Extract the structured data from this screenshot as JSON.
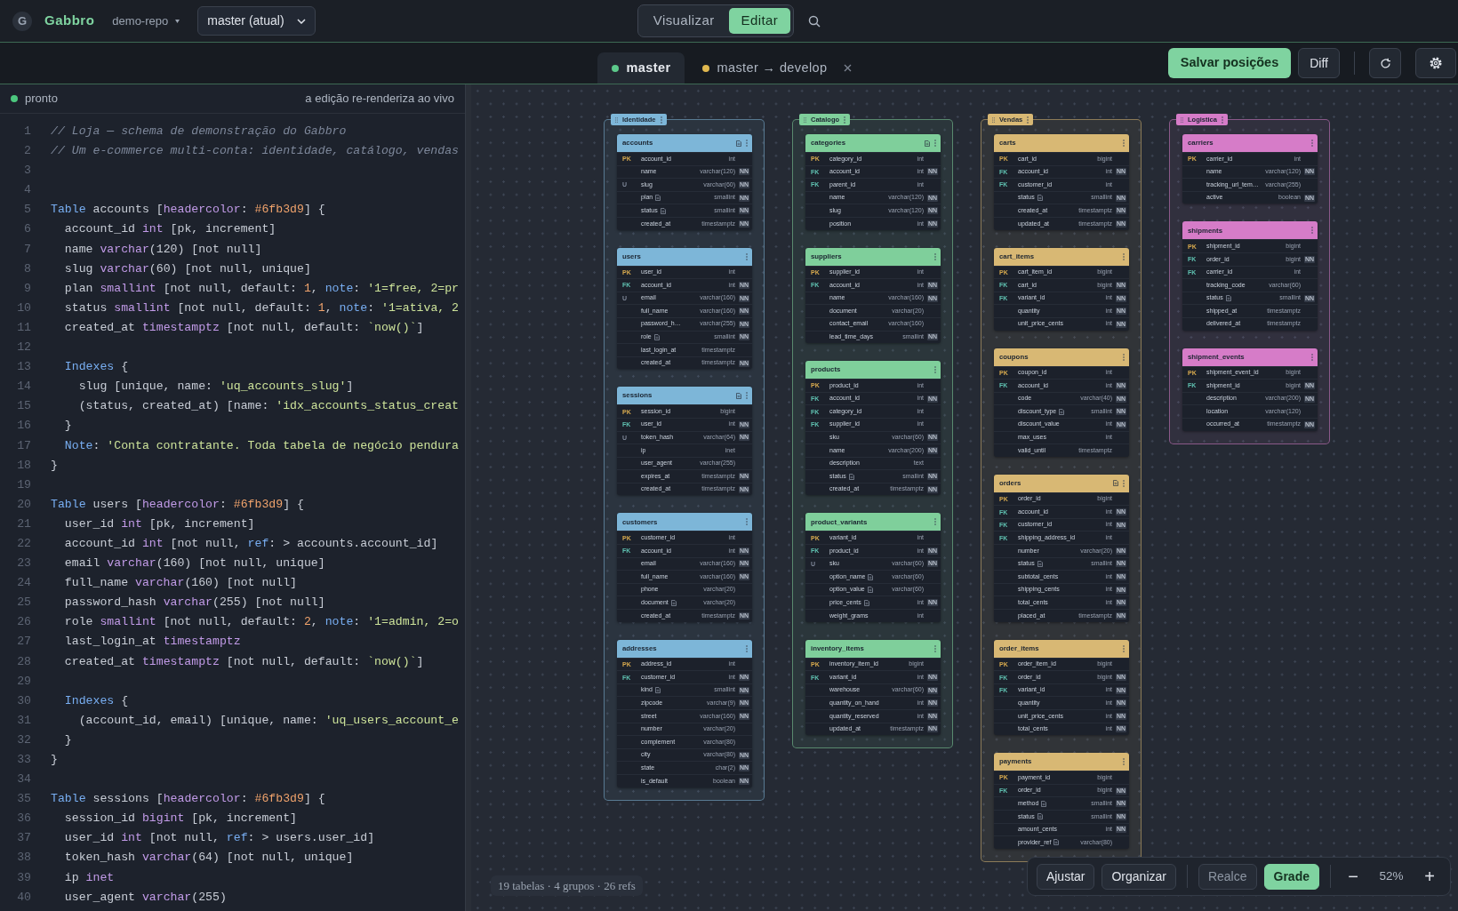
{
  "app": {
    "logo": "G",
    "name": "Gabbro",
    "repo": "demo-repo",
    "branch": "master (atual)"
  },
  "mode_tabs": [
    {
      "label": "Visualizar",
      "selected": false
    },
    {
      "label": "Editar",
      "selected": true
    }
  ],
  "file_tabs": [
    {
      "label": "master",
      "color": "#5cc98b",
      "selected": true,
      "closable": false
    },
    {
      "label": "master → develop",
      "color": "#e0b84f",
      "selected": false,
      "closable": true
    }
  ],
  "actions": {
    "save": "Salvar posições",
    "diff": "Diff"
  },
  "editor": {
    "status": "pronto",
    "status_ok": true,
    "hint": "a edição re-renderiza ao vivo",
    "lines": [
      {
        "n": "1",
        "s": [
          {
            "c": "// Loja — schema de demonstração do Gabbro"
          }
        ]
      },
      {
        "n": "2",
        "s": [
          {
            "c": "// Um e-commerce multi-conta: identidade, catálogo, vendas"
          }
        ]
      },
      {
        "n": "3"
      },
      {
        "n": "4"
      },
      {
        "n": "5",
        "s": [
          {
            "k": "Table"
          },
          {
            "p": " accounts ["
          },
          {
            "t": "headercolor"
          },
          {
            "p": ": "
          },
          {
            "n": "#6fb3d9"
          },
          {
            "p": "] {"
          }
        ]
      },
      {
        "n": "6",
        "s": [
          {
            "p": "  account_id "
          },
          {
            "t": "int"
          },
          {
            "p": " [pk, increment]"
          }
        ]
      },
      {
        "n": "7",
        "s": [
          {
            "p": "  name "
          },
          {
            "t": "varchar"
          },
          {
            "p": "(120) [not null]"
          }
        ]
      },
      {
        "n": "8",
        "s": [
          {
            "p": "  slug "
          },
          {
            "t": "varchar"
          },
          {
            "p": "(60) [not null, unique]"
          }
        ]
      },
      {
        "n": "9",
        "s": [
          {
            "p": "  plan "
          },
          {
            "t": "smallint"
          },
          {
            "p": " [not null, default: "
          },
          {
            "n": "1"
          },
          {
            "p": ", "
          },
          {
            "k": "note"
          },
          {
            "p": ": "
          },
          {
            "s": "'1=free, 2=pr"
          }
        ]
      },
      {
        "n": "10",
        "s": [
          {
            "p": "  status "
          },
          {
            "t": "smallint"
          },
          {
            "p": " [not null, default: "
          },
          {
            "n": "1"
          },
          {
            "p": ", "
          },
          {
            "k": "note"
          },
          {
            "p": ": "
          },
          {
            "s": "'1=ativa, 2"
          }
        ]
      },
      {
        "n": "11",
        "s": [
          {
            "p": "  created_at "
          },
          {
            "t": "timestamptz"
          },
          {
            "p": " [not null, default: "
          },
          {
            "s": "`now()`"
          },
          {
            "p": "]"
          }
        ]
      },
      {
        "n": "12"
      },
      {
        "n": "13",
        "s": [
          {
            "k": "  Indexes"
          },
          {
            "p": " {"
          }
        ]
      },
      {
        "n": "14",
        "s": [
          {
            "p": "    slug [unique, name: "
          },
          {
            "s": "'uq_accounts_slug'"
          },
          {
            "p": "]"
          }
        ]
      },
      {
        "n": "15",
        "s": [
          {
            "p": "    (status, created_at) [name: "
          },
          {
            "s": "'idx_accounts_status_creat"
          }
        ]
      },
      {
        "n": "16",
        "s": [
          {
            "p": "  }"
          }
        ]
      },
      {
        "n": "17",
        "s": [
          {
            "k": "  Note"
          },
          {
            "p": ": "
          },
          {
            "s": "'Conta contratante. Toda tabela de negócio pendura"
          }
        ]
      },
      {
        "n": "18",
        "s": [
          {
            "p": "}"
          }
        ]
      },
      {
        "n": "19"
      },
      {
        "n": "20",
        "s": [
          {
            "k": "Table"
          },
          {
            "p": " users ["
          },
          {
            "t": "headercolor"
          },
          {
            "p": ": "
          },
          {
            "n": "#6fb3d9"
          },
          {
            "p": "] {"
          }
        ]
      },
      {
        "n": "21",
        "s": [
          {
            "p": "  user_id "
          },
          {
            "t": "int"
          },
          {
            "p": " [pk, increment]"
          }
        ]
      },
      {
        "n": "22",
        "s": [
          {
            "p": "  account_id "
          },
          {
            "t": "int"
          },
          {
            "p": " [not null, "
          },
          {
            "k": "ref"
          },
          {
            "p": ": > accounts.account_id]"
          }
        ]
      },
      {
        "n": "23",
        "s": [
          {
            "p": "  email "
          },
          {
            "t": "varchar"
          },
          {
            "p": "(160) [not null, unique]"
          }
        ]
      },
      {
        "n": "24",
        "s": [
          {
            "p": "  full_name "
          },
          {
            "t": "varchar"
          },
          {
            "p": "(160) [not null]"
          }
        ]
      },
      {
        "n": "25",
        "s": [
          {
            "p": "  password_hash "
          },
          {
            "t": "varchar"
          },
          {
            "p": "(255) [not null]"
          }
        ]
      },
      {
        "n": "26",
        "s": [
          {
            "p": "  role "
          },
          {
            "t": "smallint"
          },
          {
            "p": " [not null, default: "
          },
          {
            "n": "2"
          },
          {
            "p": ", "
          },
          {
            "k": "note"
          },
          {
            "p": ": "
          },
          {
            "s": "'1=admin, 2=o"
          }
        ]
      },
      {
        "n": "27",
        "s": [
          {
            "p": "  last_login_at "
          },
          {
            "t": "timestamptz"
          }
        ]
      },
      {
        "n": "28",
        "s": [
          {
            "p": "  created_at "
          },
          {
            "t": "timestamptz"
          },
          {
            "p": " [not null, default: "
          },
          {
            "s": "`now()`"
          },
          {
            "p": "]"
          }
        ]
      },
      {
        "n": "29"
      },
      {
        "n": "30",
        "s": [
          {
            "k": "  Indexes"
          },
          {
            "p": " {"
          }
        ]
      },
      {
        "n": "31",
        "s": [
          {
            "p": "    (account_id, email) [unique, name: "
          },
          {
            "s": "'uq_users_account_e"
          }
        ]
      },
      {
        "n": "32",
        "s": [
          {
            "p": "  }"
          }
        ]
      },
      {
        "n": "33",
        "s": [
          {
            "p": "}"
          }
        ]
      },
      {
        "n": "34"
      },
      {
        "n": "35",
        "s": [
          {
            "k": "Table"
          },
          {
            "p": " sessions ["
          },
          {
            "t": "headercolor"
          },
          {
            "p": ": "
          },
          {
            "n": "#6fb3d9"
          },
          {
            "p": "] {"
          }
        ]
      },
      {
        "n": "36",
        "s": [
          {
            "p": "  session_id "
          },
          {
            "t": "bigint"
          },
          {
            "p": " [pk, increment]"
          }
        ]
      },
      {
        "n": "37",
        "s": [
          {
            "p": "  user_id "
          },
          {
            "t": "int"
          },
          {
            "p": " [not null, "
          },
          {
            "k": "ref"
          },
          {
            "p": ": > users.user_id]"
          }
        ]
      },
      {
        "n": "38",
        "s": [
          {
            "p": "  token_hash "
          },
          {
            "t": "varchar"
          },
          {
            "p": "(64) [not null, unique]"
          }
        ]
      },
      {
        "n": "39",
        "s": [
          {
            "p": "  ip "
          },
          {
            "t": "inet"
          }
        ]
      },
      {
        "n": "40",
        "s": [
          {
            "p": "  user_agent "
          },
          {
            "t": "varchar"
          },
          {
            "p": "(255)"
          }
        ]
      }
    ]
  },
  "canvas": {
    "stats": "19 tabelas · 4 grupos · 26 refs",
    "groups": [
      {
        "name": "Identidade",
        "color": "#7db6d8",
        "tables": [
          {
            "name": "accounts",
            "note": true,
            "columns": [
              {
                "key": "PK",
                "name": "account_id",
                "note": false,
                "type": "int"
              },
              {
                "name": "name",
                "note": false,
                "type": "varchar(120)",
                "nn": "NN"
              },
              {
                "key": "U",
                "name": "slug",
                "note": false,
                "type": "varchar(60)",
                "nn": "NN"
              },
              {
                "name": "plan",
                "note": true,
                "type": "smallint",
                "nn": "NN"
              },
              {
                "name": "status",
                "note": true,
                "type": "smallint",
                "nn": "NN"
              },
              {
                "name": "created_at",
                "note": false,
                "type": "timestamptz",
                "nn": "NN"
              }
            ]
          },
          {
            "name": "users",
            "note": false,
            "columns": [
              {
                "key": "PK",
                "name": "user_id",
                "note": false,
                "type": "int"
              },
              {
                "key": "FK",
                "name": "account_id",
                "note": false,
                "type": "int",
                "nn": "NN"
              },
              {
                "key": "U",
                "name": "email",
                "note": false,
                "type": "varchar(160)",
                "nn": "NN"
              },
              {
                "name": "full_name",
                "note": false,
                "type": "varchar(160)",
                "nn": "NN"
              },
              {
                "name": "password_h…",
                "note": false,
                "type": "varchar(255)",
                "nn": "NN"
              },
              {
                "name": "role",
                "note": true,
                "type": "smallint",
                "nn": "NN"
              },
              {
                "name": "last_login_at",
                "note": false,
                "type": "timestamptz"
              },
              {
                "name": "created_at",
                "note": false,
                "type": "timestamptz",
                "nn": "NN"
              }
            ]
          },
          {
            "name": "sessions",
            "note": true,
            "columns": [
              {
                "key": "PK",
                "name": "session_id",
                "note": false,
                "type": "bigint"
              },
              {
                "key": "FK",
                "name": "user_id",
                "note": false,
                "type": "int",
                "nn": "NN"
              },
              {
                "key": "U",
                "name": "token_hash",
                "note": false,
                "type": "varchar(64)",
                "nn": "NN"
              },
              {
                "name": "ip",
                "note": false,
                "type": "inet"
              },
              {
                "name": "user_agent",
                "note": false,
                "type": "varchar(255)"
              },
              {
                "name": "expires_at",
                "note": false,
                "type": "timestamptz",
                "nn": "NN"
              },
              {
                "name": "created_at",
                "note": false,
                "type": "timestamptz",
                "nn": "NN"
              }
            ]
          },
          {
            "name": "customers",
            "note": false,
            "columns": [
              {
                "key": "PK",
                "name": "customer_id",
                "note": false,
                "type": "int"
              },
              {
                "key": "FK",
                "name": "account_id",
                "note": false,
                "type": "int",
                "nn": "NN"
              },
              {
                "name": "email",
                "note": false,
                "type": "varchar(160)",
                "nn": "NN"
              },
              {
                "name": "full_name",
                "note": false,
                "type": "varchar(160)",
                "nn": "NN"
              },
              {
                "name": "phone",
                "note": false,
                "type": "varchar(20)"
              },
              {
                "name": "document",
                "note": true,
                "type": "varchar(20)"
              },
              {
                "name": "created_at",
                "note": false,
                "type": "timestamptz",
                "nn": "NN"
              }
            ]
          },
          {
            "name": "addresses",
            "note": false,
            "columns": [
              {
                "key": "PK",
                "name": "address_id",
                "note": false,
                "type": "int"
              },
              {
                "key": "FK",
                "name": "customer_id",
                "note": false,
                "type": "int",
                "nn": "NN"
              },
              {
                "name": "kind",
                "note": true,
                "type": "smallint",
                "nn": "NN"
              },
              {
                "name": "zipcode",
                "note": false,
                "type": "varchar(9)",
                "nn": "NN"
              },
              {
                "name": "street",
                "note": false,
                "type": "varchar(160)",
                "nn": "NN"
              },
              {
                "name": "number",
                "note": false,
                "type": "varchar(20)"
              },
              {
                "name": "complement",
                "note": false,
                "type": "varchar(80)"
              },
              {
                "name": "city",
                "note": false,
                "type": "varchar(80)",
                "nn": "NN"
              },
              {
                "name": "state",
                "note": false,
                "type": "char(2)",
                "nn": "NN"
              },
              {
                "name": "is_default",
                "note": false,
                "type": "boolean",
                "nn": "NN"
              }
            ]
          }
        ]
      },
      {
        "name": "Catalogo",
        "color": "#7fcf9b",
        "tables": [
          {
            "name": "categories",
            "note": true,
            "columns": [
              {
                "key": "PK",
                "name": "category_id",
                "note": false,
                "type": "int"
              },
              {
                "key": "FK",
                "name": "account_id",
                "note": false,
                "type": "int",
                "nn": "NN"
              },
              {
                "key": "FK",
                "name": "parent_id",
                "note": false,
                "type": "int"
              },
              {
                "name": "name",
                "note": false,
                "type": "varchar(120)",
                "nn": "NN"
              },
              {
                "name": "slug",
                "note": false,
                "type": "varchar(120)",
                "nn": "NN"
              },
              {
                "name": "position",
                "note": false,
                "type": "int",
                "nn": "NN"
              }
            ]
          },
          {
            "name": "suppliers",
            "note": false,
            "columns": [
              {
                "key": "PK",
                "name": "supplier_id",
                "note": false,
                "type": "int"
              },
              {
                "key": "FK",
                "name": "account_id",
                "note": false,
                "type": "int",
                "nn": "NN"
              },
              {
                "name": "name",
                "note": false,
                "type": "varchar(160)",
                "nn": "NN"
              },
              {
                "name": "document",
                "note": false,
                "type": "varchar(20)"
              },
              {
                "name": "contact_email",
                "note": false,
                "type": "varchar(160)"
              },
              {
                "name": "lead_time_days",
                "note": false,
                "type": "smallint",
                "nn": "NN"
              }
            ]
          },
          {
            "name": "products",
            "note": false,
            "columns": [
              {
                "key": "PK",
                "name": "product_id",
                "note": false,
                "type": "int"
              },
              {
                "key": "FK",
                "name": "account_id",
                "note": false,
                "type": "int",
                "nn": "NN"
              },
              {
                "key": "FK",
                "name": "category_id",
                "note": false,
                "type": "int"
              },
              {
                "key": "FK",
                "name": "supplier_id",
                "note": false,
                "type": "int"
              },
              {
                "name": "sku",
                "note": false,
                "type": "varchar(60)",
                "nn": "NN"
              },
              {
                "name": "name",
                "note": false,
                "type": "varchar(200)",
                "nn": "NN"
              },
              {
                "name": "description",
                "note": false,
                "type": "text"
              },
              {
                "name": "status",
                "note": true,
                "type": "smallint",
                "nn": "NN"
              },
              {
                "name": "created_at",
                "note": false,
                "type": "timestamptz",
                "nn": "NN"
              }
            ]
          },
          {
            "name": "product_variants",
            "note": false,
            "columns": [
              {
                "key": "PK",
                "name": "variant_id",
                "note": false,
                "type": "int"
              },
              {
                "key": "FK",
                "name": "product_id",
                "note": false,
                "type": "int",
                "nn": "NN"
              },
              {
                "key": "U",
                "name": "sku",
                "note": false,
                "type": "varchar(60)",
                "nn": "NN"
              },
              {
                "name": "option_name",
                "note": true,
                "type": "varchar(60)"
              },
              {
                "name": "option_value",
                "note": true,
                "type": "varchar(60)"
              },
              {
                "name": "price_cents",
                "note": true,
                "type": "int",
                "nn": "NN"
              },
              {
                "name": "weight_grams",
                "note": false,
                "type": "int"
              }
            ]
          },
          {
            "name": "inventory_items",
            "note": false,
            "columns": [
              {
                "key": "PK",
                "name": "inventory_item_id",
                "note": false,
                "type": "bigint"
              },
              {
                "key": "FK",
                "name": "variant_id",
                "note": false,
                "type": "int",
                "nn": "NN"
              },
              {
                "name": "warehouse",
                "note": false,
                "type": "varchar(60)",
                "nn": "NN"
              },
              {
                "name": "quantity_on_hand",
                "note": false,
                "type": "int",
                "nn": "NN"
              },
              {
                "name": "quantity_reserved",
                "note": false,
                "type": "int",
                "nn": "NN"
              },
              {
                "name": "updated_at",
                "note": false,
                "type": "timestamptz",
                "nn": "NN"
              }
            ]
          }
        ]
      },
      {
        "name": "Vendas",
        "color": "#d8b874",
        "tables": [
          {
            "name": "carts",
            "note": false,
            "columns": [
              {
                "key": "PK",
                "name": "cart_id",
                "note": false,
                "type": "bigint"
              },
              {
                "key": "FK",
                "name": "account_id",
                "note": false,
                "type": "int",
                "nn": "NN"
              },
              {
                "key": "FK",
                "name": "customer_id",
                "note": false,
                "type": "int"
              },
              {
                "name": "status",
                "note": true,
                "type": "smallint",
                "nn": "NN"
              },
              {
                "name": "created_at",
                "note": false,
                "type": "timestamptz",
                "nn": "NN"
              },
              {
                "name": "updated_at",
                "note": false,
                "type": "timestamptz",
                "nn": "NN"
              }
            ]
          },
          {
            "name": "cart_items",
            "note": false,
            "columns": [
              {
                "key": "PK",
                "name": "cart_item_id",
                "note": false,
                "type": "bigint"
              },
              {
                "key": "FK",
                "name": "cart_id",
                "note": false,
                "type": "bigint",
                "nn": "NN"
              },
              {
                "key": "FK",
                "name": "variant_id",
                "note": false,
                "type": "int",
                "nn": "NN"
              },
              {
                "name": "quantity",
                "note": false,
                "type": "int",
                "nn": "NN"
              },
              {
                "name": "unit_price_cents",
                "note": false,
                "type": "int",
                "nn": "NN"
              }
            ]
          },
          {
            "name": "coupons",
            "note": false,
            "columns": [
              {
                "key": "PK",
                "name": "coupon_id",
                "note": false,
                "type": "int"
              },
              {
                "key": "FK",
                "name": "account_id",
                "note": false,
                "type": "int",
                "nn": "NN"
              },
              {
                "name": "code",
                "note": false,
                "type": "varchar(40)",
                "nn": "NN"
              },
              {
                "name": "discount_type",
                "note": true,
                "type": "smallint",
                "nn": "NN"
              },
              {
                "name": "discount_value",
                "note": false,
                "type": "int",
                "nn": "NN"
              },
              {
                "name": "max_uses",
                "note": false,
                "type": "int"
              },
              {
                "name": "valid_until",
                "note": false,
                "type": "timestamptz"
              }
            ]
          },
          {
            "name": "orders",
            "note": true,
            "columns": [
              {
                "key": "PK",
                "name": "order_id",
                "note": false,
                "type": "bigint"
              },
              {
                "key": "FK",
                "name": "account_id",
                "note": false,
                "type": "int",
                "nn": "NN"
              },
              {
                "key": "FK",
                "name": "customer_id",
                "note": false,
                "type": "int",
                "nn": "NN"
              },
              {
                "key": "FK",
                "name": "shipping_address_id",
                "note": false,
                "type": "int"
              },
              {
                "name": "number",
                "note": false,
                "type": "varchar(20)",
                "nn": "NN"
              },
              {
                "name": "status",
                "note": true,
                "type": "smallint",
                "nn": "NN"
              },
              {
                "name": "subtotal_cents",
                "note": false,
                "type": "int",
                "nn": "NN"
              },
              {
                "name": "shipping_cents",
                "note": false,
                "type": "int",
                "nn": "NN"
              },
              {
                "name": "total_cents",
                "note": false,
                "type": "int",
                "nn": "NN"
              },
              {
                "name": "placed_at",
                "note": false,
                "type": "timestamptz",
                "nn": "NN"
              }
            ]
          },
          {
            "name": "order_items",
            "note": false,
            "columns": [
              {
                "key": "PK",
                "name": "order_item_id",
                "note": false,
                "type": "bigint"
              },
              {
                "key": "FK",
                "name": "order_id",
                "note": false,
                "type": "bigint",
                "nn": "NN"
              },
              {
                "key": "FK",
                "name": "variant_id",
                "note": false,
                "type": "int",
                "nn": "NN"
              },
              {
                "name": "quantity",
                "note": false,
                "type": "int",
                "nn": "NN"
              },
              {
                "name": "unit_price_cents",
                "note": false,
                "type": "int",
                "nn": "NN"
              },
              {
                "name": "total_cents",
                "note": false,
                "type": "int",
                "nn": "NN"
              }
            ]
          },
          {
            "name": "payments",
            "note": false,
            "columns": [
              {
                "key": "PK",
                "name": "payment_id",
                "note": false,
                "type": "bigint"
              },
              {
                "key": "FK",
                "name": "order_id",
                "note": false,
                "type": "bigint",
                "nn": "NN"
              },
              {
                "name": "method",
                "note": true,
                "type": "smallint",
                "nn": "NN"
              },
              {
                "name": "status",
                "note": true,
                "type": "smallint",
                "nn": "NN"
              },
              {
                "name": "amount_cents",
                "note": false,
                "type": "int",
                "nn": "NN"
              },
              {
                "name": "provider_ref",
                "note": true,
                "type": "varchar(80)"
              }
            ]
          }
        ]
      },
      {
        "name": "Logistica",
        "color": "#d67cc8",
        "tables": [
          {
            "name": "carriers",
            "note": false,
            "columns": [
              {
                "key": "PK",
                "name": "carrier_id",
                "note": false,
                "type": "int"
              },
              {
                "name": "name",
                "note": false,
                "type": "varchar(120)",
                "nn": "NN"
              },
              {
                "name": "tracking_url_tem…",
                "note": false,
                "type": "varchar(255)"
              },
              {
                "name": "active",
                "note": false,
                "type": "boolean",
                "nn": "NN"
              }
            ]
          },
          {
            "name": "shipments",
            "note": false,
            "columns": [
              {
                "key": "PK",
                "name": "shipment_id",
                "note": false,
                "type": "bigint"
              },
              {
                "key": "FK",
                "name": "order_id",
                "note": false,
                "type": "bigint",
                "nn": "NN"
              },
              {
                "key": "FK",
                "name": "carrier_id",
                "note": false,
                "type": "int"
              },
              {
                "name": "tracking_code",
                "note": false,
                "type": "varchar(60)"
              },
              {
                "name": "status",
                "note": true,
                "type": "smallint",
                "nn": "NN"
              },
              {
                "name": "shipped_at",
                "note": false,
                "type": "timestamptz"
              },
              {
                "name": "delivered_at",
                "note": false,
                "type": "timestamptz"
              }
            ]
          },
          {
            "name": "shipment_events",
            "note": false,
            "columns": [
              {
                "key": "PK",
                "name": "shipment_event_id",
                "note": false,
                "type": "bigint"
              },
              {
                "key": "FK",
                "name": "shipment_id",
                "note": false,
                "type": "bigint",
                "nn": "NN"
              },
              {
                "name": "description",
                "note": false,
                "type": "varchar(200)",
                "nn": "NN"
              },
              {
                "name": "location",
                "note": false,
                "type": "varchar(120)"
              },
              {
                "name": "occurred_at",
                "note": false,
                "type": "timestamptz",
                "nn": "NN"
              }
            ]
          }
        ]
      }
    ],
    "toolbar": {
      "actions": [
        "Ajustar",
        "Organizar"
      ],
      "toggles": [
        {
          "label": "Realce",
          "selected": false
        },
        {
          "label": "Grade",
          "selected": true
        }
      ],
      "zoom": {
        "minus": "−",
        "readout": "52%",
        "plus": "+"
      }
    }
  }
}
